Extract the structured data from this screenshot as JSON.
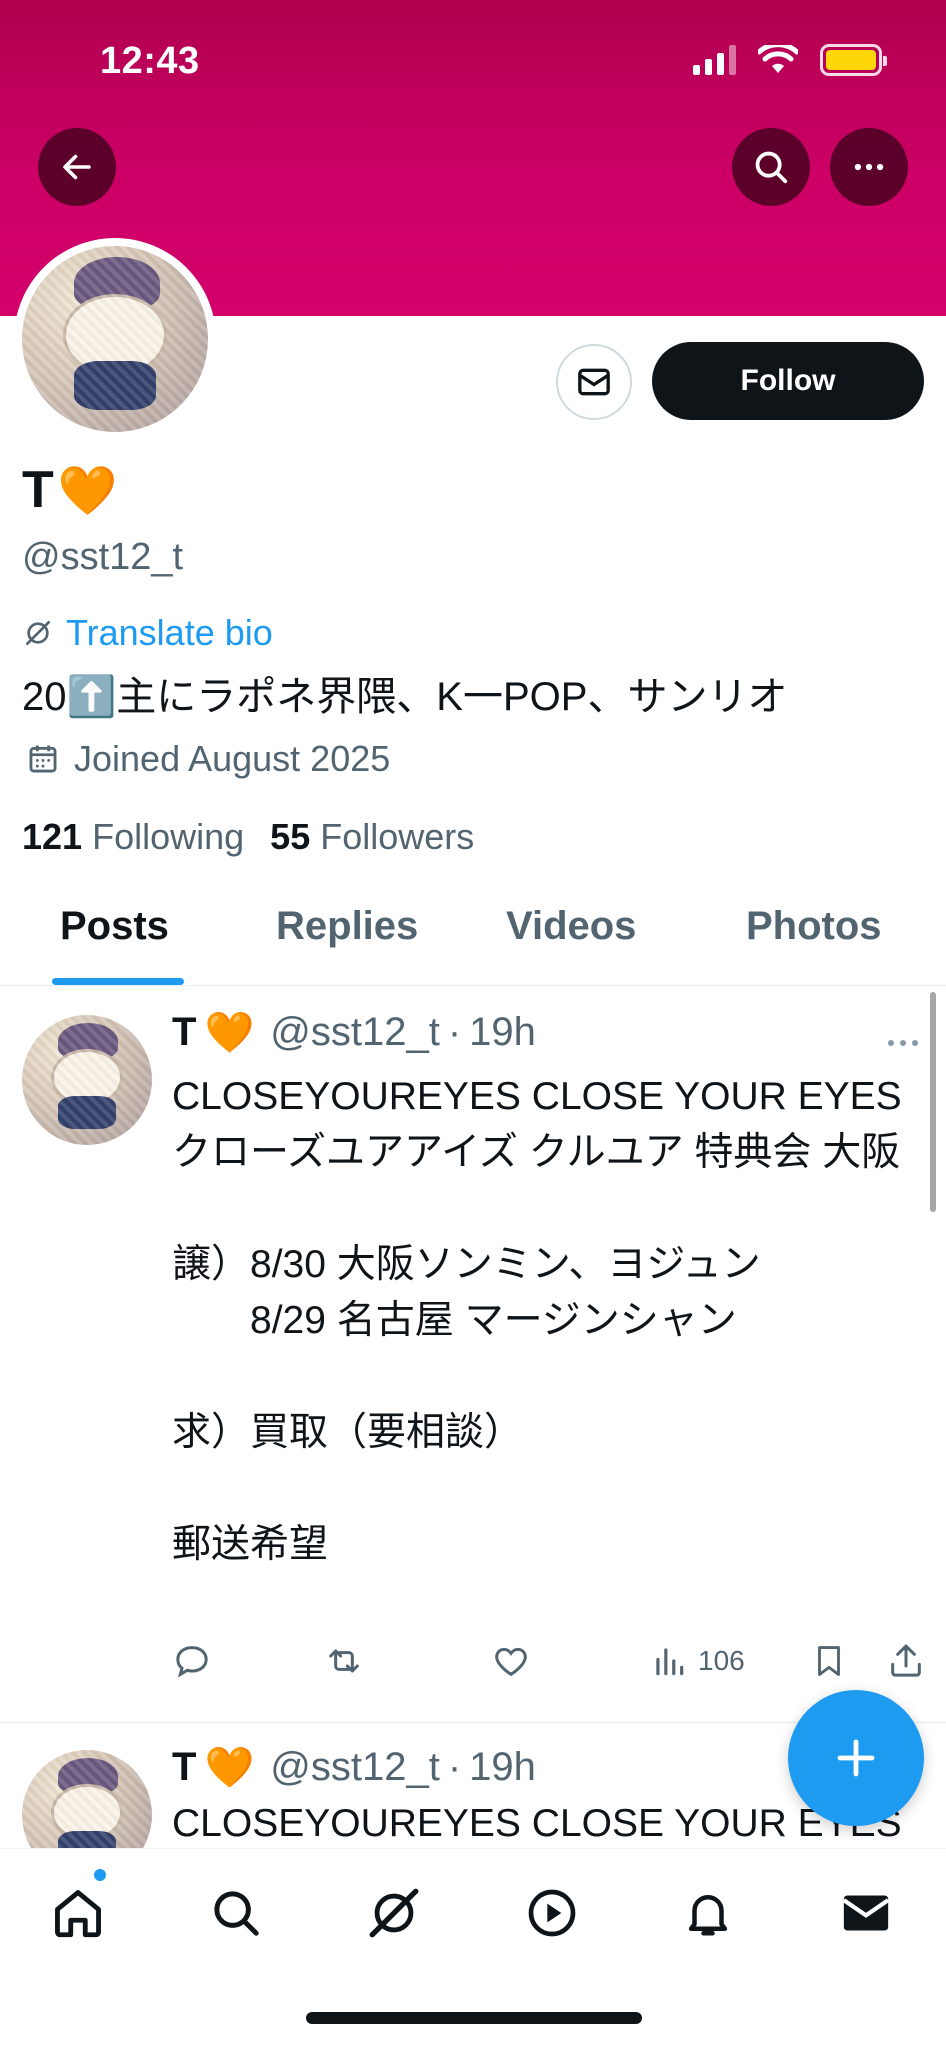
{
  "status_bar": {
    "time": "12:43"
  },
  "profile": {
    "display_name": "T",
    "name_emoji": "🧡",
    "handle": "@sst12_t",
    "translate_label": "Translate bio",
    "bio": "20⬆️主にラポネ界隈、K一POP、サンリオ",
    "joined": "Joined August 2025",
    "following_count": "121",
    "following_label": "Following",
    "followers_count": "55",
    "followers_label": "Followers",
    "follow_label": "Follow"
  },
  "tabs": [
    {
      "label": "Posts",
      "active": true
    },
    {
      "label": "Replies",
      "active": false
    },
    {
      "label": "Videos",
      "active": false
    },
    {
      "label": "Photos",
      "active": false
    }
  ],
  "tweets": [
    {
      "name": "T",
      "name_emoji": "🧡",
      "handle": "@sst12_t",
      "separator": "·",
      "time": "19h",
      "body": "CLOSEYOUREYES CLOSE YOUR EYES クローズユアアイズ クルユア 特典会 大阪\n\n譲）8/30 大阪ソンミン、ヨジュン\n　　8/29 名古屋 マージンシャン\n\n求）買取（要相談）\n\n郵送希望",
      "views": "106"
    },
    {
      "name": "T",
      "name_emoji": "🧡",
      "handle": "@sst12_t",
      "separator": "·",
      "time": "19h",
      "body": "CLOSEYOUREYES CLOSE YOUR EYES"
    }
  ],
  "colors": {
    "accent": "#1d9bf0",
    "banner": "#cc0066",
    "text": "#0f1419",
    "muted": "#536471"
  },
  "icons": {
    "back": "arrow-left-icon",
    "search": "search-icon",
    "more": "more-horizontal-icon",
    "message": "envelope-icon",
    "translate": "translate-icon",
    "calendar": "calendar-icon",
    "reply": "reply-icon",
    "retweet": "retweet-icon",
    "like": "heart-icon",
    "views": "views-icon",
    "bookmark": "bookmark-icon",
    "share": "share-icon",
    "compose": "plus-icon",
    "nav_home": "home-icon",
    "nav_search": "search-icon",
    "nav_grok": "grok-icon",
    "nav_video": "play-icon",
    "nav_notifications": "bell-icon",
    "nav_messages": "envelope-icon"
  }
}
